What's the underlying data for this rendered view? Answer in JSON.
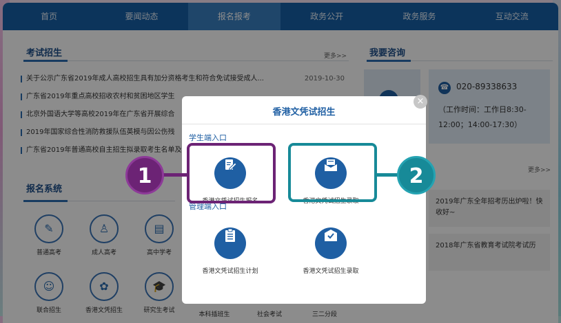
{
  "nav": [
    "首页",
    "要闻动态",
    "报名报考",
    "政务公开",
    "政务服务",
    "互动交流"
  ],
  "exam": {
    "title": "考试招生",
    "more": "更多>>",
    "news": [
      {
        "text": "关于公示广东省2019年成人高校招生具有加分资格考生和符合免试接受成人...",
        "date": "2019-10-30"
      },
      {
        "text": "广东省2019年重点高校招收农村和贫困地区学生",
        "date": ""
      },
      {
        "text": "北京外国语大学等高校2019年在广东省开展综合",
        "date": ""
      },
      {
        "text": "2019年国家综合性消防救援队伍英模与因公伤残",
        "date": ""
      },
      {
        "text": "广东省2019年普通高校自主招生拟录取考生名单及项计",
        "date": ""
      }
    ]
  },
  "consult": {
    "title": "我要咨询",
    "phone": "020-89338633",
    "hours": "（工作时间：工作日8:30-12:00；14:00-17:30）",
    "more": "更多>>",
    "news": [
      "2019年广东全年招考历出炉啦！快收好~",
      "2018年广东省教育考试院考试历"
    ]
  },
  "system": {
    "title": "报名系统",
    "items": [
      {
        "label": "普通高考",
        "icon": "document-icon"
      },
      {
        "label": "成人高考",
        "icon": "user-icon"
      },
      {
        "label": "高中学考",
        "icon": "book-icon"
      },
      {
        "label": "联合招生",
        "icon": "group-icon"
      },
      {
        "label": "香港文凭招生",
        "icon": "bauhinia-icon"
      },
      {
        "label": "研究生考试",
        "icon": "graduation-cap-icon"
      },
      {
        "label": "本科插班生",
        "icon": ""
      },
      {
        "label": "社会考试",
        "icon": ""
      },
      {
        "label": "三二分段",
        "icon": ""
      }
    ]
  },
  "modal": {
    "title": "香港文凭试招生",
    "student_heading": "学生端入口",
    "admin_heading": "管理端入口",
    "student_items": [
      "香港文凭试招生报名",
      "香港文凭试招生录取"
    ],
    "admin_items": [
      "香港文凭试招生计划",
      "香港文凭试招生录取"
    ],
    "close": "×"
  },
  "annotations": {
    "badge1": "1",
    "badge2": "2",
    "color1": "#6c2375",
    "color2": "#178a98"
  }
}
